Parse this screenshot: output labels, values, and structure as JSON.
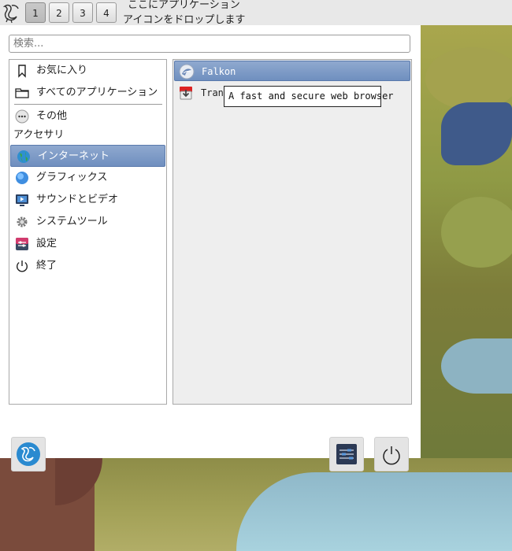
{
  "taskbar": {
    "desktops": [
      "1",
      "2",
      "3",
      "4"
    ],
    "active_desktop": "1",
    "quicklaunch_hint_line1": "ここにアプリケーション",
    "quicklaunch_hint_line2": "アイコンをドロップします"
  },
  "menu": {
    "search_placeholder": "検索...",
    "categories": [
      {
        "label": "お気に入り",
        "icon": "bookmark-icon"
      },
      {
        "label": "すべてのアプリケーション",
        "icon": "folder-icon"
      },
      {
        "label": "その他",
        "icon": "more-icon"
      },
      {
        "label": "インターネット",
        "icon": "globe-icon",
        "selected": true
      },
      {
        "label": "グラフィックス",
        "icon": "graphics-icon"
      },
      {
        "label": "サウンドとビデオ",
        "icon": "multimedia-icon"
      },
      {
        "label": "システムツール",
        "icon": "gear-icon"
      },
      {
        "label": "設定",
        "icon": "settings-icon"
      },
      {
        "label": "終了",
        "icon": "power-icon"
      }
    ],
    "section_header": "アクセサリ",
    "apps": [
      {
        "label": "Falkon",
        "icon": "falkon-icon",
        "selected": true
      },
      {
        "label": "Trans",
        "icon": "transmission-icon"
      }
    ],
    "tooltip": "A fast and secure web browser"
  },
  "colors": {
    "selection": "#7f9cc8",
    "panel_bg": "#e8e8e8"
  }
}
